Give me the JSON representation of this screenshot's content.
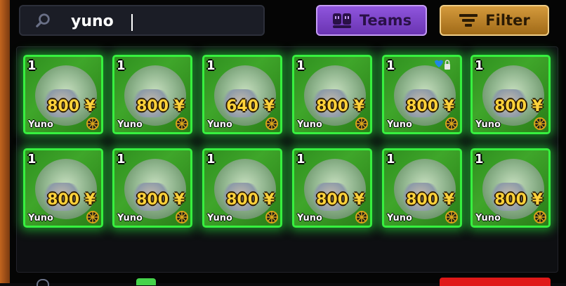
{
  "search": {
    "value": "yuno"
  },
  "teams_button": {
    "label": "Teams"
  },
  "filter_button": {
    "label": "Filter"
  },
  "units": [
    {
      "level": "1",
      "price": "800 ¥",
      "name": "Yuno",
      "favorited": false
    },
    {
      "level": "1",
      "price": "800 ¥",
      "name": "Yuno",
      "favorited": false
    },
    {
      "level": "1",
      "price": "640 ¥",
      "name": "Yuno",
      "favorited": false
    },
    {
      "level": "1",
      "price": "800 ¥",
      "name": "Yuno",
      "favorited": false
    },
    {
      "level": "1",
      "price": "800 ¥",
      "name": "Yuno",
      "favorited": true
    },
    {
      "level": "1",
      "price": "800 ¥",
      "name": "Yuno",
      "favorited": false
    },
    {
      "level": "1",
      "price": "800 ¥",
      "name": "Yuno",
      "favorited": false
    },
    {
      "level": "1",
      "price": "800 ¥",
      "name": "Yuno",
      "favorited": false
    },
    {
      "level": "1",
      "price": "800 ¥",
      "name": "Yuno",
      "favorited": false
    },
    {
      "level": "1",
      "price": "800 ¥",
      "name": "Yuno",
      "favorited": false
    },
    {
      "level": "1",
      "price": "800 ¥",
      "name": "Yuno",
      "favorited": false
    },
    {
      "level": "1",
      "price": "800 ¥",
      "name": "Yuno",
      "favorited": false
    }
  ],
  "colors": {
    "card_border": "#37f03f",
    "price": "#ffd23a",
    "teams": "#7a44c6",
    "filter": "#c08530"
  }
}
